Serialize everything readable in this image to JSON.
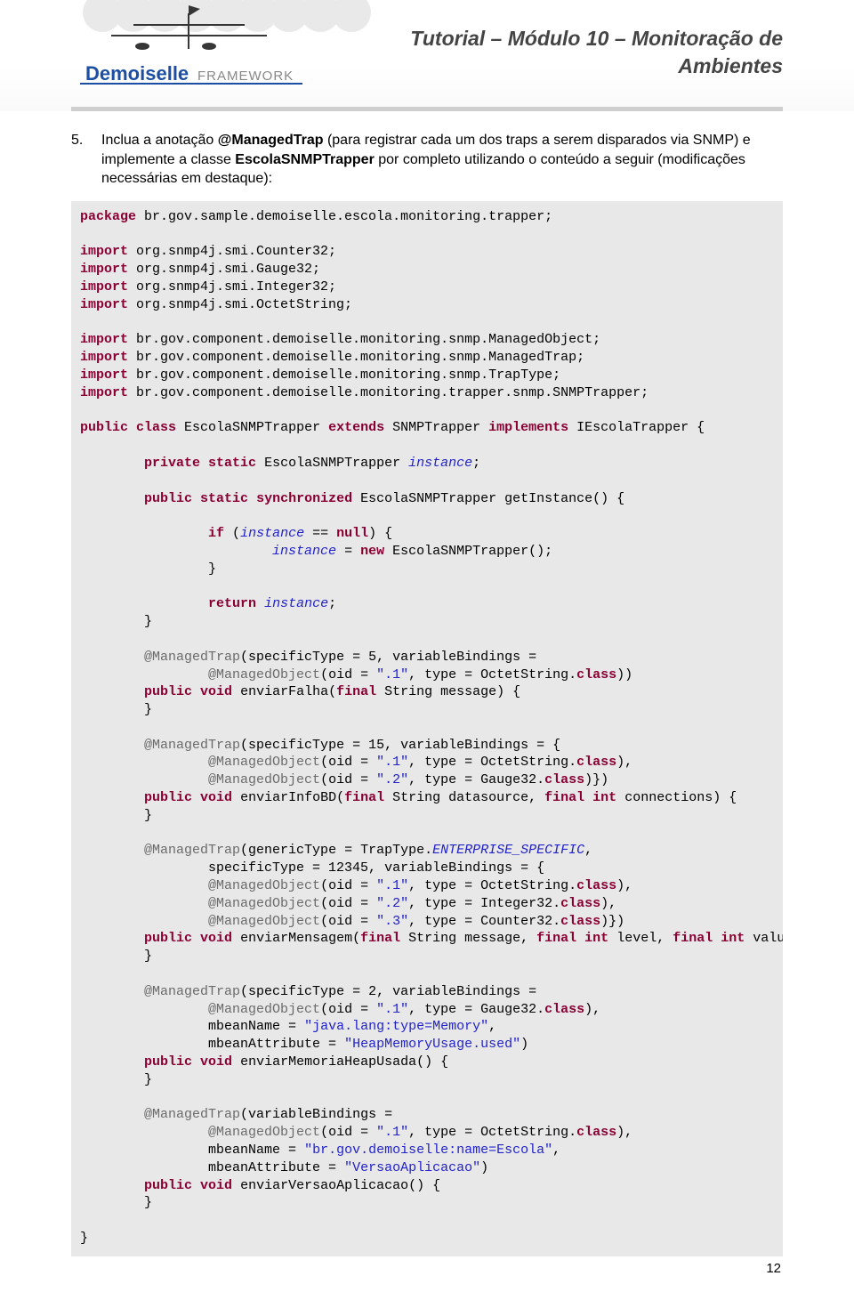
{
  "header": {
    "title_line1": "Tutorial – Módulo 10 – Monitoração de",
    "title_line2": "Ambientes",
    "brand_main": "Demoiselle",
    "brand_sub": "FRAMEWORK"
  },
  "step": {
    "num": "5.",
    "pre": "Inclua a anotação ",
    "annotation": "@ManagedTrap",
    "mid": " (para registrar cada um dos traps a serem disparados via SNMP) e implemente a classe ",
    "classname": "EscolaSNMPTrapper",
    "post": " por completo utilizando o conteúdo a seguir (modificações necessárias em destaque):"
  },
  "code": {
    "package_kw": "package",
    "package_val": " br.gov.sample.demoiselle.escola.monitoring.trapper;",
    "import_kw": "import",
    "imp1": " org.snmp4j.smi.Counter32;",
    "imp2": " org.snmp4j.smi.Gauge32;",
    "imp3": " org.snmp4j.smi.Integer32;",
    "imp4": " org.snmp4j.smi.OctetString;",
    "imp5": " br.gov.component.demoiselle.monitoring.snmp.ManagedObject;",
    "imp6": " br.gov.component.demoiselle.monitoring.snmp.ManagedTrap;",
    "imp7": " br.gov.component.demoiselle.monitoring.snmp.TrapType;",
    "imp8": " br.gov.component.demoiselle.monitoring.trapper.snmp.SNMPTrapper;",
    "public_kw": "public",
    "class_kw": "class",
    "extends_kw": "extends",
    "implements_kw": "implements",
    "private_kw": "private",
    "static_kw": "static",
    "sync_kw": "synchronized",
    "void_kw": "void",
    "final_kw": "final",
    "int_kw": "int",
    "if_kw": "if",
    "null_kw": "null",
    "new_kw": "new",
    "return_kw": "return",
    "class_line_a": " EscolaSNMPTrapper ",
    "class_line_b": " SNMPTrapper ",
    "class_line_c": " IEscolaTrapper {",
    "field_a": " EscolaSNMPTrapper ",
    "instance": "instance",
    "semi": ";",
    "getinst_a": " EscolaSNMPTrapper getInstance() {",
    "ifcond_a": " (",
    "ifcond_b": " == ",
    "ifcond_c": ") {",
    "assign_a": " = ",
    "assign_b": " EscolaSNMPTrapper();",
    "close": "}",
    "ret_a": " ",
    "trap1_l1": "@ManagedTrap",
    "trap1_l1b": "(specificType = 5, variableBindings = ",
    "trap1_l2a": "@ManagedObject",
    "trap1_l2b": "(oid = ",
    "trap1_oid1": "\".1\"",
    "trap1_l2c": ", type = OctetString.",
    "classword": "class",
    "trap1_l2d": "))",
    "m1_a": " enviarFalha(",
    "m1_b": " String message) {",
    "trap2_l1b": "(specificType = 15, variableBindings = {",
    "trap2_l2c": ", type = OctetString.",
    "trap2_l2d": "),",
    "trap2_oid2": "\".2\"",
    "trap2_l3c": ", type = Gauge32.",
    "trap2_l3d": ")})",
    "m2_a": " enviarInfoBD(",
    "m2_b": " String datasource, ",
    "m2_c": " connections) {",
    "trap3_l1b": "(genericType = TrapType.",
    "trap3_enum": "ENTERPRISE_SPECIFIC",
    "trap3_l1c": ",",
    "trap3_l2": "specificType = 12345, variableBindings = {",
    "trap3_l3c": ", type = OctetString.",
    "trap3_l4c": ", type = Integer32.",
    "trap3_oid3": "\".3\"",
    "trap3_l5c": ", type = Counter32.",
    "trap3_l5d": ")})",
    "m3_a": " enviarMensagem(",
    "m3_b": " String message, ",
    "m3_c": " level, ",
    "m3_d": " value) {",
    "trap4_l1b": "(specificType = 2, variableBindings = ",
    "trap4_l2c": ", type = Gauge32.",
    "trap4_l2d": "),",
    "trap4_l3a": "mbeanName = ",
    "trap4_mbean": "\"java.lang:type=Memory\"",
    "trap4_l3b": ",",
    "trap4_l4a": "mbeanAttribute = ",
    "trap4_attr": "\"HeapMemoryUsage.used\"",
    "trap4_l4b": ")",
    "m4_a": " enviarMemoriaHeapUsada() {",
    "trap5_l1b": "(variableBindings = ",
    "trap5_l2c": ", type = OctetString.",
    "trap5_l2d": "),",
    "trap5_mbean": "\"br.gov.demoiselle:name=Escola\"",
    "trap5_attr": "\"VersaoAplicacao\"",
    "m5_a": " enviarVersaoAplicacao() {"
  },
  "page_number": "12"
}
